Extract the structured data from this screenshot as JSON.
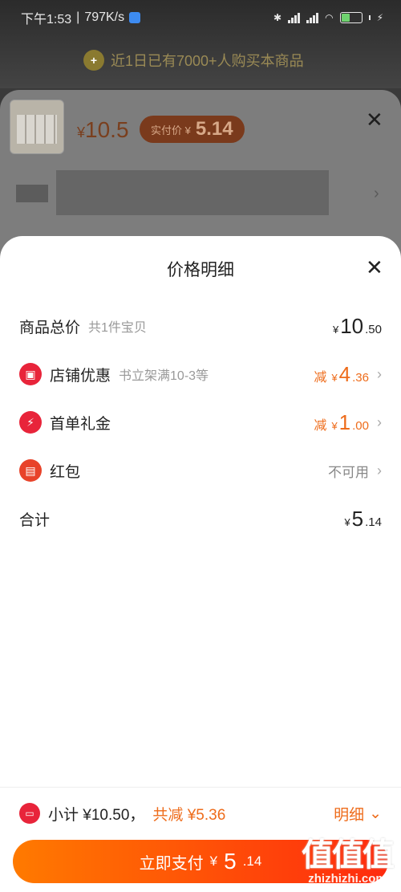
{
  "status_bar": {
    "time": "下午1:53",
    "speed": "797K/s",
    "battery": "44",
    "battery_fraction": 0.44
  },
  "background": {
    "banner_text": "近1日已有7000+人购买本商品",
    "product_price_symbol": "¥",
    "product_price": "10.5",
    "actual_price_label": "实付价 ¥",
    "actual_price": "5.14"
  },
  "modal": {
    "title": "价格明细",
    "rows": [
      {
        "label": "商品总价",
        "sub": "共1件宝贝",
        "prefix": "",
        "yen": "¥",
        "int": "10",
        "dec": ".50",
        "icon": "",
        "color": "#222222"
      },
      {
        "label": "店铺优惠",
        "sub": "书立架满10-3等",
        "prefix": "减",
        "yen": "¥",
        "int": "4",
        "dec": ".36",
        "icon": "shop-icon",
        "color": "#ee6c1b"
      },
      {
        "label": "首单礼金",
        "sub": "",
        "prefix": "减",
        "yen": "¥",
        "int": "1",
        "dec": ".00",
        "icon": "lightning-icon",
        "color": "#ee6c1b"
      },
      {
        "label": "红包",
        "sub": "",
        "status": "不可用",
        "icon": "red-packet-icon"
      },
      {
        "label": "合计",
        "yen": "¥",
        "int": "5",
        "dec": ".14"
      }
    ]
  },
  "footer": {
    "subtotal_label": "小计",
    "subtotal_value": "¥10.50，",
    "discount_label": "共减",
    "discount_value": "¥5.36",
    "detail_toggle": "明细",
    "pay_button_label": "立即支付",
    "pay_yen": "¥",
    "pay_int": "5",
    "pay_dec": ".14"
  },
  "watermark": {
    "big": "值值值",
    "small": "zhizhizhi.com"
  },
  "colors": {
    "accent": "#ee6c1b",
    "brand_red": "#e8243a",
    "pay_gradient_start": "#ff7a00",
    "pay_gradient_end": "#ff2a0e"
  }
}
